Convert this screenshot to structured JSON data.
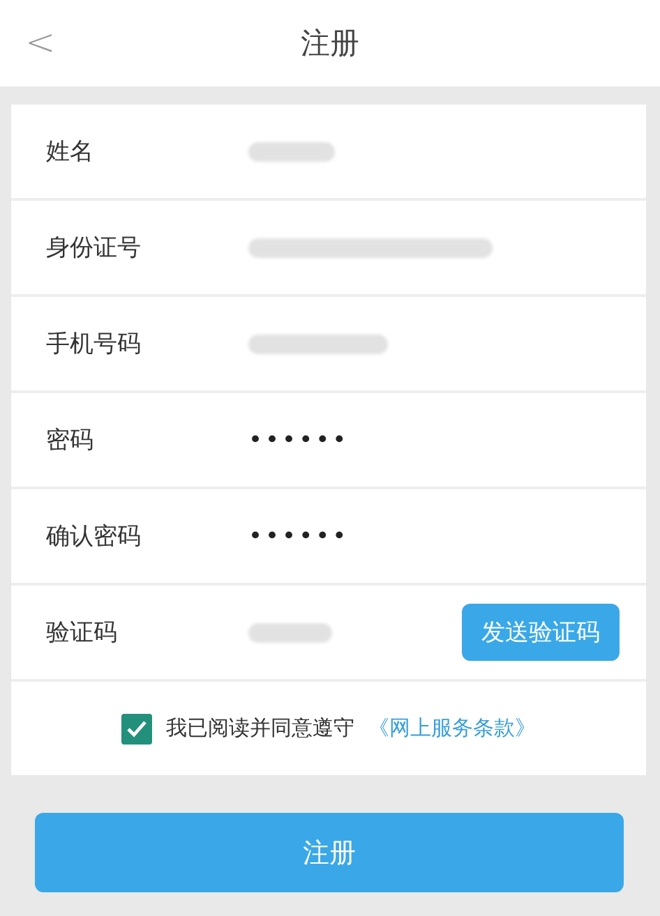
{
  "header": {
    "back_icon": "<",
    "title": "注册"
  },
  "fields": [
    {
      "label": "姓名",
      "kind": "redacted"
    },
    {
      "label": "身份证号",
      "kind": "redacted"
    },
    {
      "label": "手机号码",
      "kind": "redacted"
    },
    {
      "label": "密码",
      "kind": "password",
      "value": "••••••"
    },
    {
      "label": "确认密码",
      "kind": "password",
      "value": "••••••"
    },
    {
      "label": "验证码",
      "kind": "redacted",
      "button": "发送验证码"
    }
  ],
  "agreement": {
    "checked": true,
    "text": "我已阅读并同意遵守",
    "link": "《网上服务条款》"
  },
  "submit": "注册"
}
